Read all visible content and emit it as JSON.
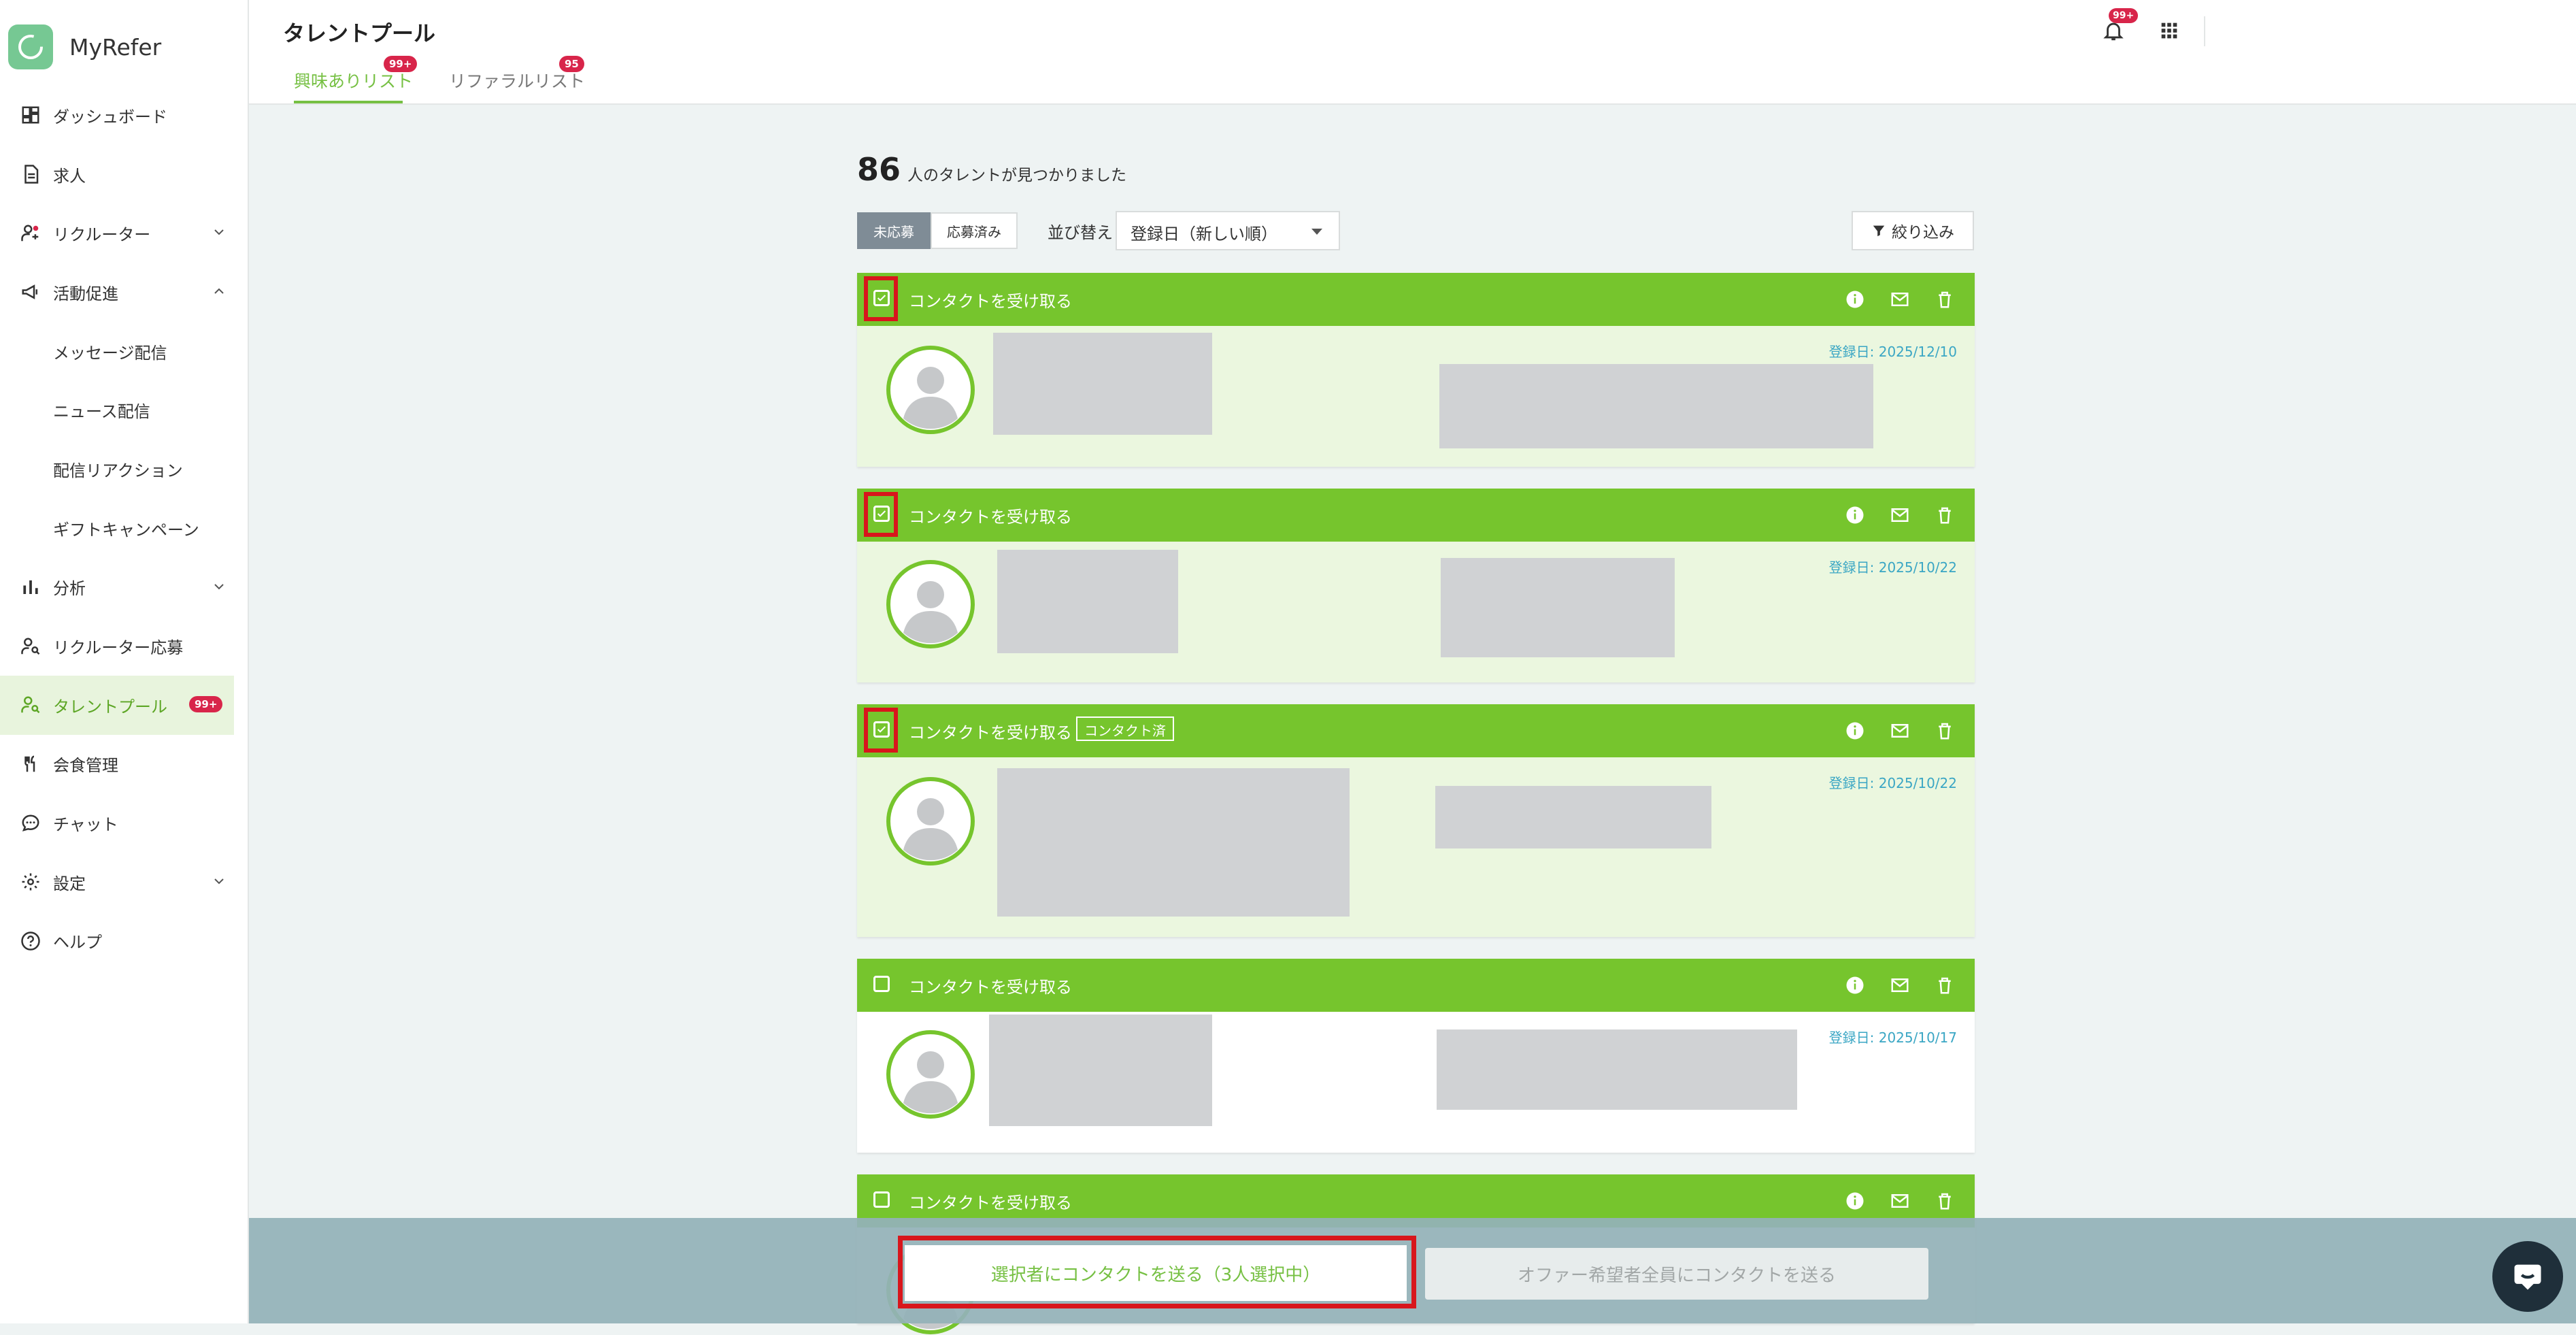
{
  "app": {
    "name": "MyRefer"
  },
  "sidebar": {
    "items": [
      {
        "label": "ダッシュボード",
        "icon": "dashboard-icon"
      },
      {
        "label": "求人",
        "icon": "document-icon"
      },
      {
        "label": "リクルーター",
        "icon": "recruiter-icon",
        "expand": "down"
      },
      {
        "label": "活動促進",
        "icon": "megaphone-icon",
        "expand": "up"
      },
      {
        "label": "メッセージ配信",
        "sub": true
      },
      {
        "label": "ニュース配信",
        "sub": true
      },
      {
        "label": "配信リアクション",
        "sub": true
      },
      {
        "label": "ギフトキャンペーン",
        "sub": true
      },
      {
        "label": "分析",
        "icon": "bar-chart-icon",
        "expand": "down"
      },
      {
        "label": "リクルーター応募",
        "icon": "person-search-icon"
      },
      {
        "label": "タレントプール",
        "icon": "talent-pool-icon",
        "active": true,
        "badge": "99+"
      },
      {
        "label": "会食管理",
        "icon": "cutlery-icon"
      },
      {
        "label": "チャット",
        "icon": "chat-bubble-icon"
      },
      {
        "label": "設定",
        "icon": "gear-icon",
        "expand": "down"
      },
      {
        "label": "ヘルプ",
        "icon": "help-icon"
      }
    ]
  },
  "header": {
    "title": "タレントプール",
    "tabs": [
      {
        "label": "興味ありリスト",
        "badge": "99+",
        "active": true
      },
      {
        "label": "リファラルリスト",
        "badge": "95",
        "active": false
      }
    ],
    "notification_badge": "99+"
  },
  "results": {
    "count": "86",
    "text": "人のタレントが見つかりました"
  },
  "filters": {
    "segments": [
      {
        "label": "未応募",
        "active": true
      },
      {
        "label": "応募済み",
        "active": false
      }
    ],
    "sort_label": "並び替え",
    "sort_value": "登録日（新しい順）",
    "filter_label": "絞り込み"
  },
  "cards": [
    {
      "label": "コンタクトを受け取る",
      "checked": true,
      "tag": "",
      "date": "登録日: 2025/12/10"
    },
    {
      "label": "コンタクトを受け取る",
      "checked": true,
      "tag": "",
      "date": "登録日: 2025/10/22"
    },
    {
      "label": "コンタクトを受け取る",
      "checked": true,
      "tag": "コンタクト済",
      "date": "登録日: 2025/10/22"
    },
    {
      "label": "コンタクトを受け取る",
      "checked": false,
      "tag": "",
      "date": "登録日: 2025/10/17"
    },
    {
      "label": "コンタクトを受け取る",
      "checked": false,
      "tag": "",
      "date": ""
    }
  ],
  "bottom": {
    "send_selected": "選択者にコンタクトを送る（3人選択中）",
    "send_all": "オファー希望者全員にコンタクトを送る"
  },
  "colors": {
    "brand_green": "#76c52d",
    "badge_red": "#d8254a",
    "highlight_red": "#d8161c",
    "date_blue": "#3aa6c4"
  }
}
